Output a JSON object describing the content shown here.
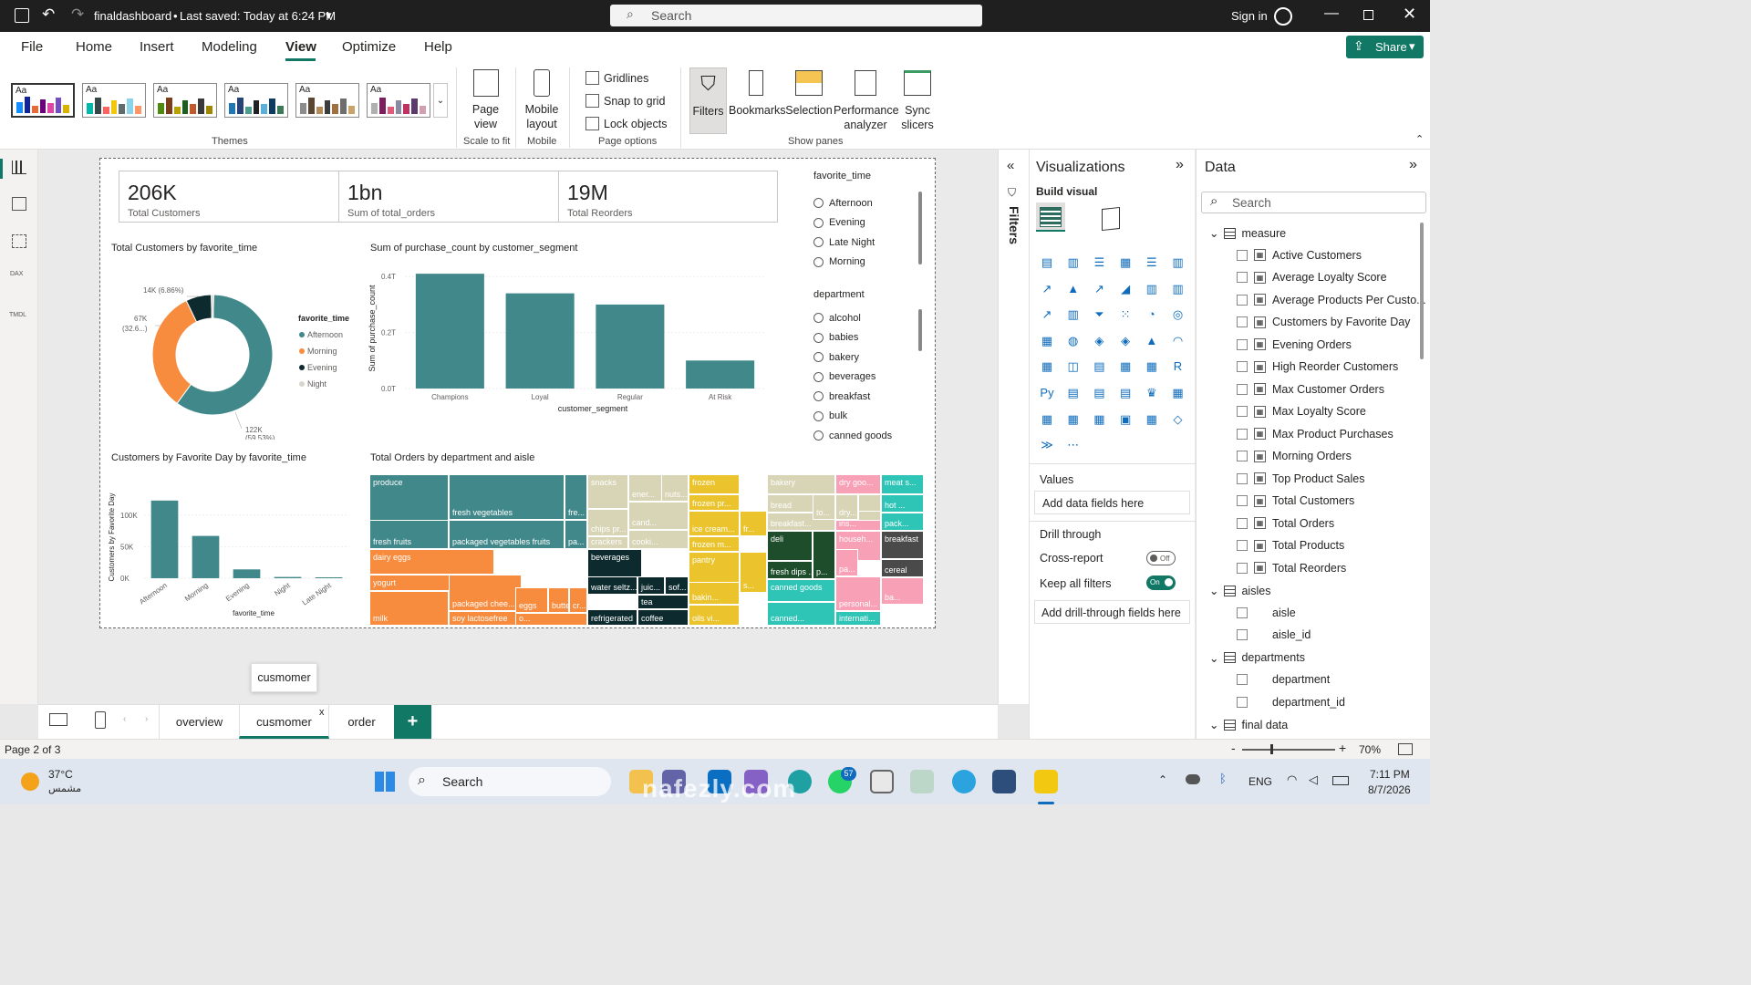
{
  "titlebar": {
    "filename": "finaldashboard",
    "saved": "Last saved: Today at 6:24 PM",
    "search_placeholder": "Search",
    "signin": "Sign in"
  },
  "menu": [
    "File",
    "Home",
    "Insert",
    "Modeling",
    "View",
    "Optimize",
    "Help"
  ],
  "menu_active": "View",
  "share": "Share",
  "ribbon": {
    "themes_label": "Themes",
    "theme_aa": "Aa",
    "page_view": "Page view",
    "scale_to_fit": "Scale to fit",
    "mobile_layout": "Mobile layout",
    "mobile": "Mobile",
    "gridlines": "Gridlines",
    "snap_to_grid": "Snap to grid",
    "lock_objects": "Lock objects",
    "page_options": "Page options",
    "filters": "Filters",
    "bookmarks": "Bookmarks",
    "selection": "Selection",
    "performance": "Performance analyzer",
    "sync_slicers": "Sync slicers",
    "show_panes": "Show panes"
  },
  "kpis": [
    {
      "value": "206K",
      "label": "Total Customers"
    },
    {
      "value": "1bn",
      "label": "Sum of total_orders"
    },
    {
      "value": "19M",
      "label": "Total Reorders"
    }
  ],
  "slicer_time": {
    "title": "favorite_time",
    "items": [
      "Afternoon",
      "Evening",
      "Late Night",
      "Morning"
    ]
  },
  "slicer_dept": {
    "title": "department",
    "items": [
      "alcohol",
      "babies",
      "bakery",
      "beverages",
      "breakfast",
      "bulk",
      "canned goods"
    ]
  },
  "donut": {
    "title": "Total Customers by favorite_time",
    "legend_title": "favorite_time",
    "legend": [
      "Afternoon",
      "Morning",
      "Evening",
      "Night"
    ],
    "colors": [
      "#41888a",
      "#f78c3f",
      "#0d2b2e",
      "#d8d6cc"
    ],
    "labels": [
      "14K (6.86%)",
      "67K",
      "(32.6...)",
      "122K",
      "(59.53%)"
    ]
  },
  "chart_data": [
    {
      "type": "pie",
      "title": "Total Customers by favorite_time",
      "categories": [
        "Afternoon",
        "Morning",
        "Evening",
        "Night"
      ],
      "values": [
        122000,
        67000,
        14000,
        1300
      ],
      "percent": [
        59.53,
        32.6,
        6.86,
        0.6
      ]
    },
    {
      "type": "bar",
      "title": "Sum of purchase_count by customer_segment",
      "xlabel": "customer_segment",
      "ylabel": "Sum of purchase_count",
      "categories": [
        "Champions",
        "Loyal",
        "Regular",
        "At Risk"
      ],
      "values": [
        0.41,
        0.34,
        0.3,
        0.1
      ],
      "yticks": [
        "0.4T",
        "0.2T",
        "0.0T"
      ],
      "ylim": [
        0,
        0.43
      ]
    },
    {
      "type": "bar",
      "title": "Customers by Favorite Day by favorite_time",
      "xlabel": "favorite_time",
      "ylabel": "Customers by Favorite Day",
      "categories": [
        "Afternoon",
        "Morning",
        "Evening",
        "Night",
        "Late Night"
      ],
      "values": [
        123000,
        67000,
        14000,
        2000,
        1000
      ],
      "yticks": [
        "100K",
        "50K",
        "0K"
      ],
      "ylim": [
        0,
        130000
      ]
    },
    {
      "type": "table",
      "title": "Total Orders by department and aisle",
      "labels": [
        "produce",
        "fresh vegetables",
        "fre...",
        "fresh fruits",
        "packaged vegetables fruits",
        "pa...",
        "dairy eggs",
        "yogurt",
        "packaged chee...",
        "milk",
        "soy lactosefree",
        "eggs",
        "butter",
        "cr...",
        "o...",
        "snacks",
        "chips pr...",
        "ener...",
        "nuts...",
        "cand...",
        "crackers",
        "cooki...",
        "beverages",
        "water seltz...",
        "juic...",
        "sof...",
        "tea",
        "refrigerated",
        "coffee",
        "frozen",
        "frozen pr...",
        "ice cream...",
        "fr...",
        "frozen m...",
        "pantry",
        "co...",
        "s...",
        "bakin...",
        "oils vi...",
        "bakery",
        "bread",
        "breakfast...",
        "deli",
        "fresh dips ...",
        "p...",
        "canned goods",
        "canned...",
        "dry goo...",
        "to...",
        "dry...",
        "p...",
        "gra...",
        "ins...",
        "househ...",
        "pa...",
        "personal...",
        "internati...",
        "meat s...",
        "hot ...",
        "pack...",
        "breakfast",
        "cereal",
        "ba..."
      ]
    }
  ],
  "treemap": {
    "title": "Total Orders by department and aisle"
  },
  "visualizations": {
    "title": "Visualizations",
    "build_visual": "Build visual",
    "values": "Values",
    "add_data": "Add data fields here",
    "drill_through": "Drill through",
    "cross_report": "Cross-report",
    "cross_state": "Off",
    "keep_filters": "Keep all filters",
    "keep_state": "On",
    "add_drill": "Add drill-through fields here"
  },
  "filters_label": "Filters",
  "data": {
    "title": "Data",
    "search": "Search",
    "tables": [
      {
        "name": "measure",
        "fields": [
          "Active Customers",
          "Average Loyalty Score",
          "Average Products Per Custo...",
          "Customers by Favorite Day",
          "Evening Orders",
          "High Reorder Customers",
          "Max Customer Orders",
          "Max Loyalty Score",
          "Max Product Purchases",
          "Morning Orders",
          "Top Product Sales",
          "Total Customers",
          "Total Orders",
          "Total Products",
          "Total Reorders"
        ]
      },
      {
        "name": "aisles",
        "fields": [
          "aisle",
          "aisle_id"
        ]
      },
      {
        "name": "departments",
        "fields": [
          "department",
          "department_id"
        ]
      },
      {
        "name": "final data",
        "fields": []
      }
    ]
  },
  "tabs": [
    "overview",
    "cusmomer",
    "order"
  ],
  "active_tab": "cusmomer",
  "tooltip": "cusmomer",
  "status": {
    "page": "Page 2 of 3",
    "zoom": "70%"
  },
  "taskbar": {
    "temp": "37°C",
    "weather": "مشمس",
    "search": "Search",
    "lang": "ENG",
    "time": "7:11 PM",
    "date": "8/7/2026",
    "badge": "57",
    "watermark": "nafezly.com"
  }
}
